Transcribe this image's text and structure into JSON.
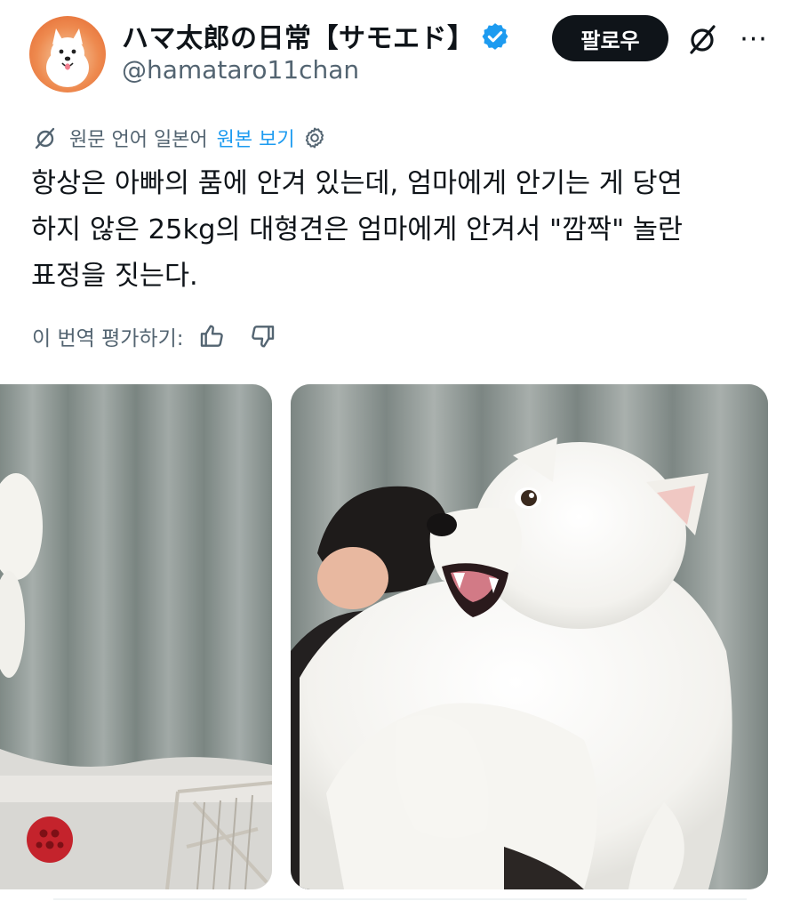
{
  "author": {
    "display_name": "ハマ太郎の日常【サモエド】",
    "handle": "@hamataro11chan",
    "verified": true
  },
  "actions": {
    "follow_label": "팔로우",
    "more_label": "···"
  },
  "translation": {
    "source_note": "원문 언어 일본어",
    "view_original": "원본 보기"
  },
  "tweet": {
    "lines": [
      "항상은 아빠의 품에 안겨 있는데, 엄마에게 안기는 게 당연",
      "하지 않은 25kg의 대형견은 엄마에게 안겨서 \"깜짝\" 놀란",
      "표정을 짓는다."
    ]
  },
  "rate": {
    "label": "이 번역 평가하기:"
  },
  "colors": {
    "text": "#0f1419",
    "secondary": "#536471",
    "accent": "#1d9bf0",
    "follow_bg": "#0f1419"
  },
  "icons": {
    "verified": "verified-badge-icon",
    "grok": "grok-icon",
    "translate": "translate-icon",
    "settings": "settings-gear-icon",
    "thumbs_up": "thumbs-up-icon",
    "thumbs_down": "thumbs-down-icon"
  }
}
